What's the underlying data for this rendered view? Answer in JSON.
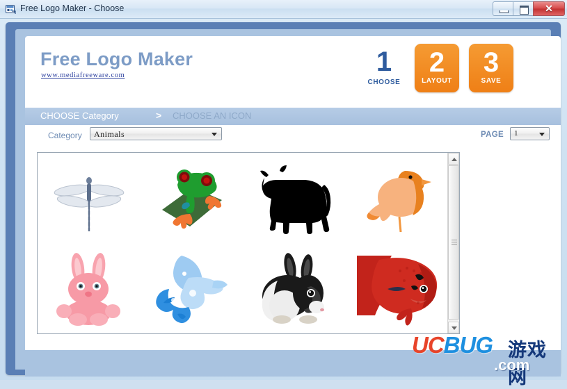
{
  "window": {
    "title": "Free Logo Maker - Choose",
    "icon": "app-icon",
    "controls": {
      "minimize": "minimize-button",
      "maximize": "maximize-button",
      "close_label": "✕"
    }
  },
  "header": {
    "brand": "Free Logo Maker",
    "url": "www.mediafreeware.com",
    "steps": [
      {
        "number": "1",
        "label": "CHOOSE",
        "state": "active",
        "color": "#2f5c9e"
      },
      {
        "number": "2",
        "label": "LAYOUT",
        "state": "inactive",
        "color": "#f28a21"
      },
      {
        "number": "3",
        "label": "SAVE",
        "state": "inactive",
        "color": "#f28a21"
      }
    ]
  },
  "breadcrumb": {
    "current": "CHOOSE Category",
    "separator": ">",
    "next": "CHOOSE AN ICON"
  },
  "controls": {
    "category_label": "Category",
    "category_value": "Animals",
    "category_options": [
      "Animals"
    ],
    "page_label": "PAGE",
    "page_value": "1",
    "page_options": [
      "1"
    ]
  },
  "icon_grid": {
    "items": [
      {
        "name": "dragonfly",
        "alt": "Dragonfly icon"
      },
      {
        "name": "frog",
        "alt": "Red-eyed tree frog icon"
      },
      {
        "name": "cow",
        "alt": "Black cow silhouette icon"
      },
      {
        "name": "bird",
        "alt": "Orange bird icon"
      },
      {
        "name": "bunny",
        "alt": "Pink bunny icon"
      },
      {
        "name": "dove",
        "alt": "Blue dove icon"
      },
      {
        "name": "rabbit",
        "alt": "Black and white rabbit icon"
      },
      {
        "name": "fish",
        "alt": "Red fish icon"
      }
    ],
    "scrollbar": {
      "up": "scroll-up",
      "down": "scroll-down"
    }
  },
  "watermark": {
    "uc": "UC",
    "bug": "BUG",
    "cn": "游戏网",
    "com": ".com"
  }
}
